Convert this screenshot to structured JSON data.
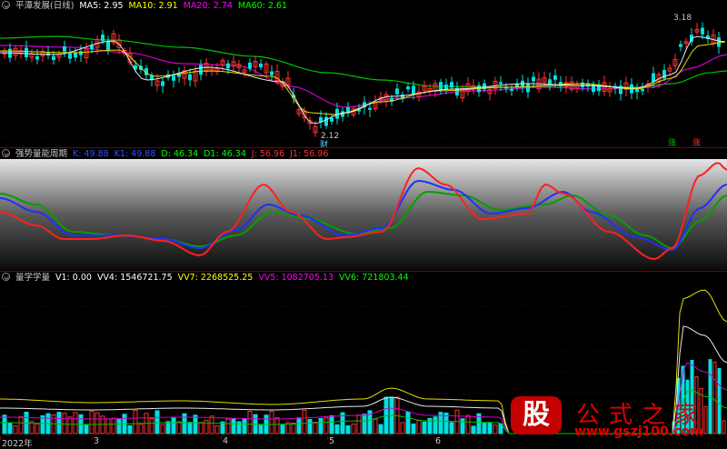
{
  "main_panel": {
    "title": "平潭发展(日线)",
    "indicators": [
      {
        "label": "MA5: 2.95",
        "color": "#ffffff"
      },
      {
        "label": "MA10: 2.91",
        "color": "#ffff00"
      },
      {
        "label": "MA20: 2.74",
        "color": "#ff00ff"
      },
      {
        "label": "MA60: 2.61",
        "color": "#00ff00"
      }
    ],
    "high_marker": "3.18",
    "low_marker": "2.12",
    "low_tag": "财",
    "tag_left": "涨",
    "tag_right": "涨",
    "tag_left_color": "#00c000",
    "tag_right_color": "#ff3030"
  },
  "kdj_panel": {
    "title": "强势量能周期",
    "indicators": [
      {
        "label": "K: 49.88",
        "color": "#3050ff"
      },
      {
        "label": "K1: 49.88",
        "color": "#3050ff"
      },
      {
        "label": "D: 46.34",
        "color": "#00ff00"
      },
      {
        "label": "D1: 46.34",
        "color": "#00ff00"
      },
      {
        "label": "J: 56.96",
        "color": "#ff3030"
      },
      {
        "label": "J1: 56.96",
        "color": "#ff3030"
      }
    ]
  },
  "volume_panel": {
    "title": "量学学量",
    "indicators": [
      {
        "label": "V1: 0.00",
        "color": "#ffffff"
      },
      {
        "label": "VV4: 1546721.75",
        "color": "#ffffff"
      },
      {
        "label": "VV7: 2268525.25",
        "color": "#ffff00"
      },
      {
        "label": "VV5: 1082705.13",
        "color": "#ff00ff"
      },
      {
        "label": "VV6: 721803.44",
        "color": "#00ff00"
      }
    ]
  },
  "date_axis": {
    "labels": [
      "2022年",
      "3",
      "4",
      "5",
      "6"
    ]
  },
  "watermark": {
    "badge": "股",
    "name": "公式之家",
    "url": "www.gszj100.com"
  },
  "colors": {
    "up": "#ff3030",
    "down": "#00e0e0",
    "separator": "#7a0000"
  }
}
